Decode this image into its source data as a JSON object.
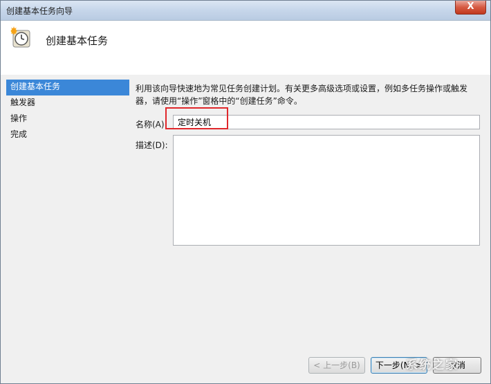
{
  "window": {
    "title": "创建基本任务向导",
    "close_symbol": "X"
  },
  "header": {
    "title": "创建基本任务",
    "icon": "scheduled-task-clock-icon"
  },
  "steps": [
    {
      "label": "创建基本任务",
      "active": true
    },
    {
      "label": "触发器",
      "active": false
    },
    {
      "label": "操作",
      "active": false
    },
    {
      "label": "完成",
      "active": false
    }
  ],
  "content": {
    "intro": "利用该向导快速地为常见任务创建计划。有关更多高级选项或设置，例如多任务操作或触发器，请使用“操作”窗格中的“创建任务”命令。",
    "name_label": "名称(A):",
    "name_value": "定时关机",
    "description_label": "描述(D):",
    "description_value": ""
  },
  "buttons": {
    "back": "< 上一步(B)",
    "next": "下一步(N) >",
    "cancel": "取消"
  },
  "watermark": "系统之家",
  "colors": {
    "selected_step": "#3b87d8",
    "highlight_box": "#e0272b",
    "close_button": "#d65a42"
  }
}
